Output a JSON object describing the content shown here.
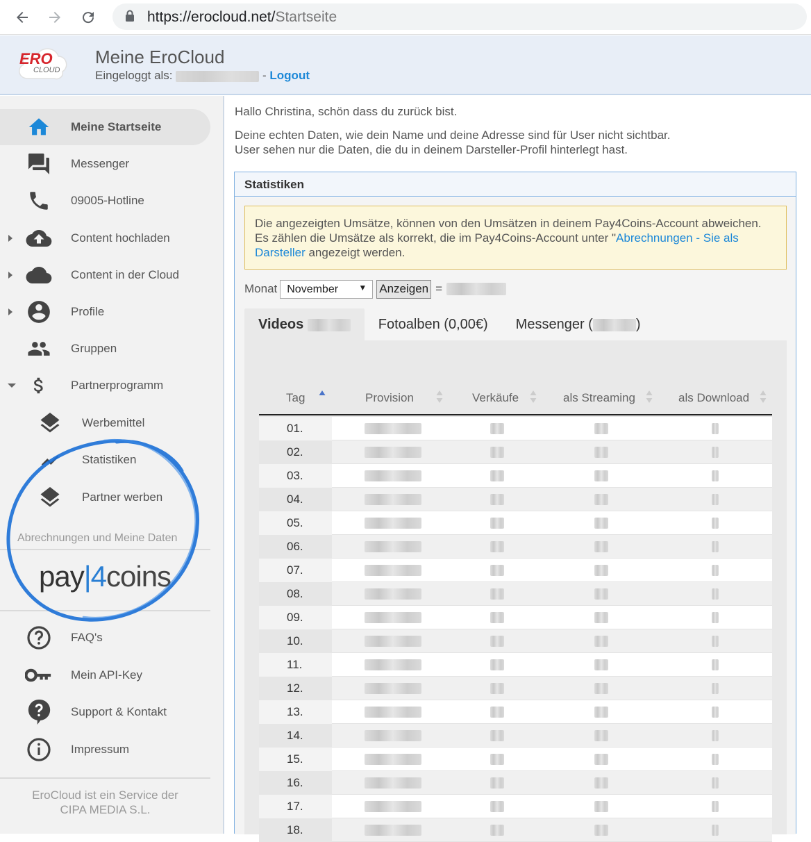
{
  "browser": {
    "url_host": "https://erocloud.net/",
    "url_path": "Startseite"
  },
  "header": {
    "logo_top": "ERO",
    "logo_bottom": "CLOUD",
    "title": "Meine EroCloud",
    "logged_in_label": "Eingeloggt als:",
    "logout_sep": "-",
    "logout_label": "Logout"
  },
  "sidebar": {
    "items": [
      {
        "label": "Meine Startseite",
        "icon": "home-icon"
      },
      {
        "label": "Messenger",
        "icon": "chat-icon"
      },
      {
        "label": "09005-Hotline",
        "icon": "phone-icon"
      },
      {
        "label": "Content hochladen",
        "icon": "cloud-upload-icon"
      },
      {
        "label": "Content in der Cloud",
        "icon": "cloud-icon"
      },
      {
        "label": "Profile",
        "icon": "account-circle-icon"
      },
      {
        "label": "Gruppen",
        "icon": "group-icon"
      },
      {
        "label": "Partnerprogramm",
        "icon": "dollar-icon"
      },
      {
        "label": "Werbemittel",
        "icon": "layers-icon"
      },
      {
        "label": "Statistiken",
        "icon": "trend-line-icon"
      },
      {
        "label": "Partner werben",
        "icon": "layers-icon"
      }
    ],
    "section_label": "Abrechnungen und Meine Daten",
    "brand": {
      "pay": "pay",
      "sep": "|",
      "four": "4",
      "coins": "coins"
    },
    "bottom_items": [
      {
        "label": "FAQ's",
        "icon": "question-circle-icon"
      },
      {
        "label": "Mein API-Key",
        "icon": "key-icon"
      },
      {
        "label": "Support & Kontakt",
        "icon": "help-bubble-icon"
      },
      {
        "label": "Impressum",
        "icon": "info-icon"
      }
    ],
    "footer_line1": "EroCloud ist ein Service der",
    "footer_line2": "CIPA MEDIA S.L.",
    "colors": {
      "circle": "#1a6fd6",
      "accent": "#1c88d8"
    }
  },
  "main": {
    "greeting": "Hallo Christina, schön dass du zurück bist.",
    "privacy_line1": "Deine echten Daten, wie dein Name und deine Adresse sind für User nicht sichtbar.",
    "privacy_line2": "User sehen nur die Daten, die du in deinem Darsteller-Profil hinterlegt hast.",
    "panel_title": "Statistiken",
    "notice_text1": "Die angezeigten Umsätze, können von den Umsätzen in deinem Pay4Coins-Account abweichen. Es zählen die Umsätze als korrekt, die im Pay4Coins-Account unter \"",
    "notice_link": "Abrechnungen - Sie als Darsteller",
    "notice_text2": " angezeigt werden.",
    "month_label": "Monat",
    "month_value": "November",
    "show_button": "Anzeigen",
    "equals": "=",
    "tabs": [
      {
        "label": "Videos"
      },
      {
        "label": "Fotoalben (0,00€)"
      },
      {
        "label_prefix": "Messenger (",
        "label_suffix": ")"
      }
    ],
    "table": {
      "columns": [
        "Tag",
        "Provision",
        "Verkäufe",
        "als Streaming",
        "als Download"
      ],
      "days": [
        "01.",
        "02.",
        "03.",
        "04.",
        "05.",
        "06.",
        "07.",
        "08.",
        "09.",
        "10.",
        "11.",
        "12.",
        "13.",
        "14.",
        "15.",
        "16.",
        "17.",
        "18."
      ]
    }
  }
}
